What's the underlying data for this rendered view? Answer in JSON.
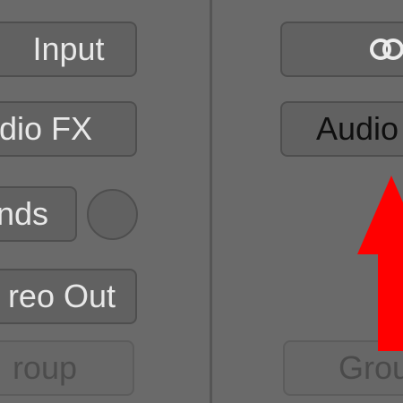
{
  "left_strip": {
    "input_label": "Input",
    "audio_fx_label": "dio FX",
    "sends_label": "nds",
    "output_label": "reo Out",
    "group_label": "roup"
  },
  "right_strip": {
    "link_icon": "stereo-link-icon",
    "audio_fx_label": "Audio",
    "group_label": "Grou"
  },
  "annotation": {
    "arrow_color": "#ff0000"
  }
}
